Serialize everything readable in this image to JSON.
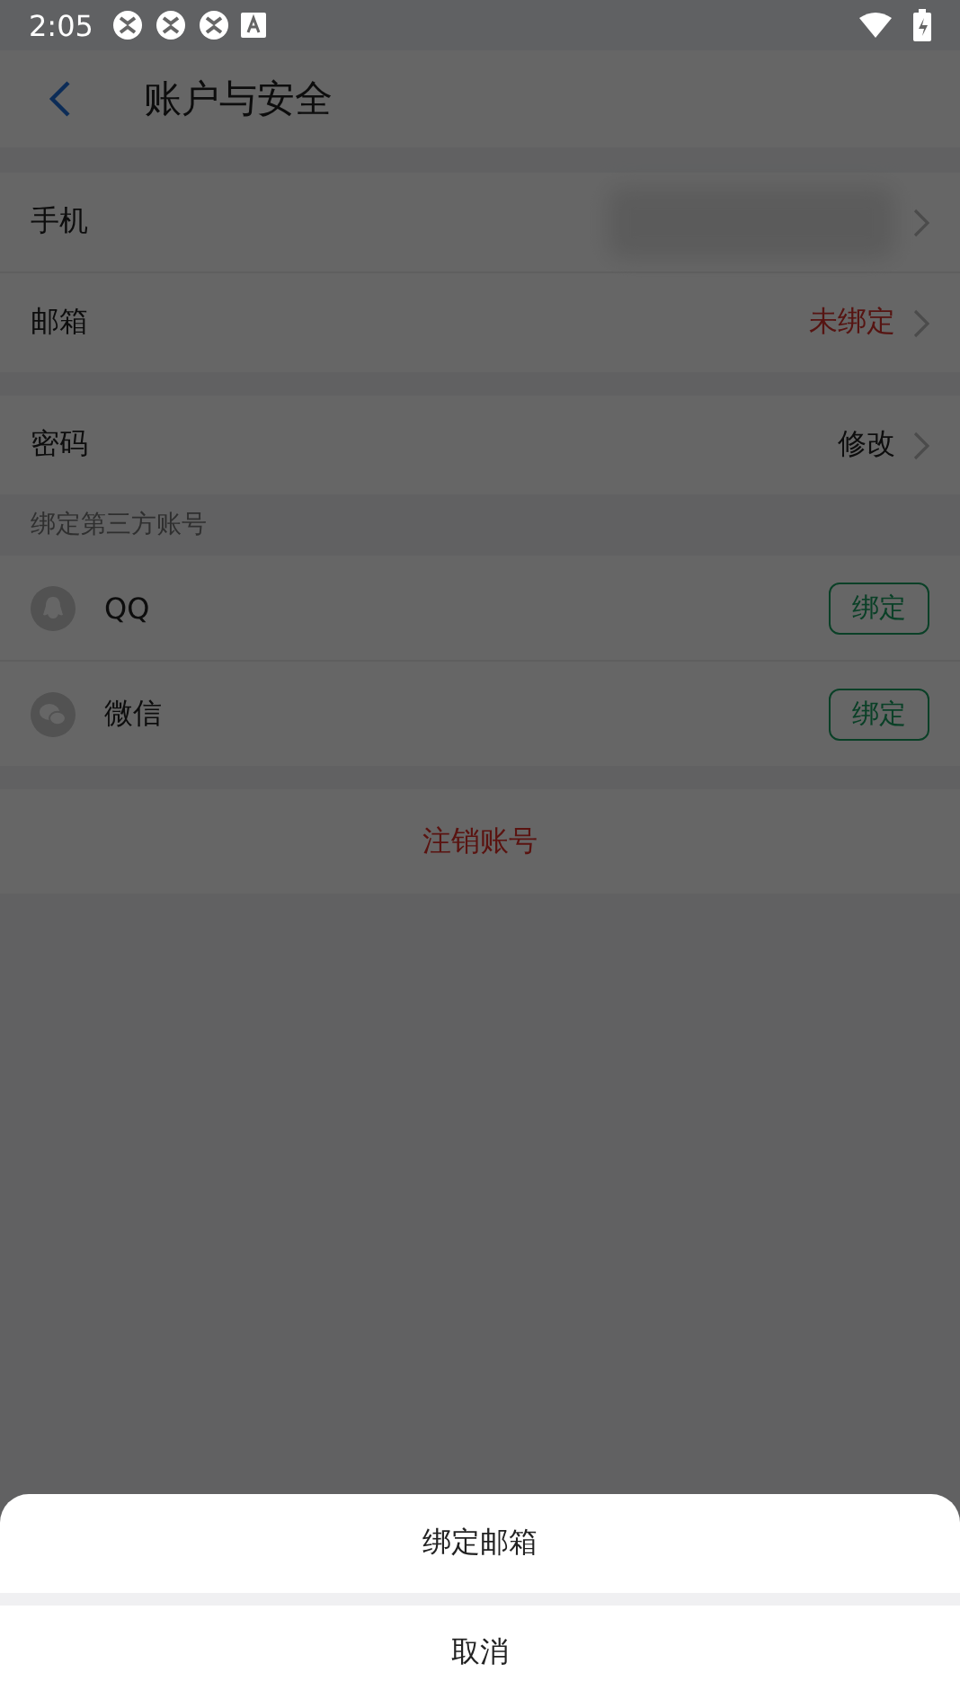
{
  "status_bar": {
    "time": "2:05"
  },
  "header": {
    "title": "账户与安全"
  },
  "account_rows": [
    {
      "label": "手机",
      "value_blurred": true
    },
    {
      "label": "邮箱",
      "value": "未绑定",
      "warning": true
    }
  ],
  "password_row": {
    "label": "密码",
    "value": "修改",
    "warning": false
  },
  "third_party": {
    "title": "绑定第三方账号",
    "items": [
      {
        "kind": "qq",
        "name": "QQ",
        "button": "绑定"
      },
      {
        "kind": "wechat",
        "name": "微信",
        "button": "绑定"
      }
    ]
  },
  "delete_account": "注销账号",
  "sheet": {
    "options": [
      "绑定邮箱"
    ],
    "cancel": "取消"
  }
}
